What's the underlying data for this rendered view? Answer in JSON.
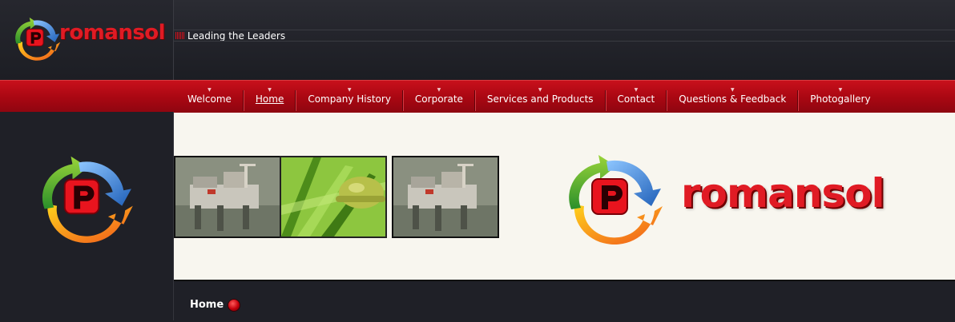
{
  "header": {
    "brand": "romansol",
    "tagline": "Leading the Leaders"
  },
  "nav": {
    "items": [
      {
        "label": "Welcome"
      },
      {
        "label": "Home",
        "active": true
      },
      {
        "label": "Company History"
      },
      {
        "label": "Corporate"
      },
      {
        "label": "Services and Products"
      },
      {
        "label": "Contact"
      },
      {
        "label": "Questions & Feedback"
      },
      {
        "label": "Photogallery"
      }
    ]
  },
  "banner": {
    "brand": "romansol",
    "thumbnails": [
      "oil-rig-photo",
      "hard-hat-grass-photo",
      "oil-rig-photo"
    ]
  },
  "content": {
    "page_heading": "Home"
  },
  "colors": {
    "brand_red": "#e01b24",
    "nav_red": "#b20a15",
    "dark_bg": "#1f2027",
    "banner_bg": "#f8f6ef"
  }
}
